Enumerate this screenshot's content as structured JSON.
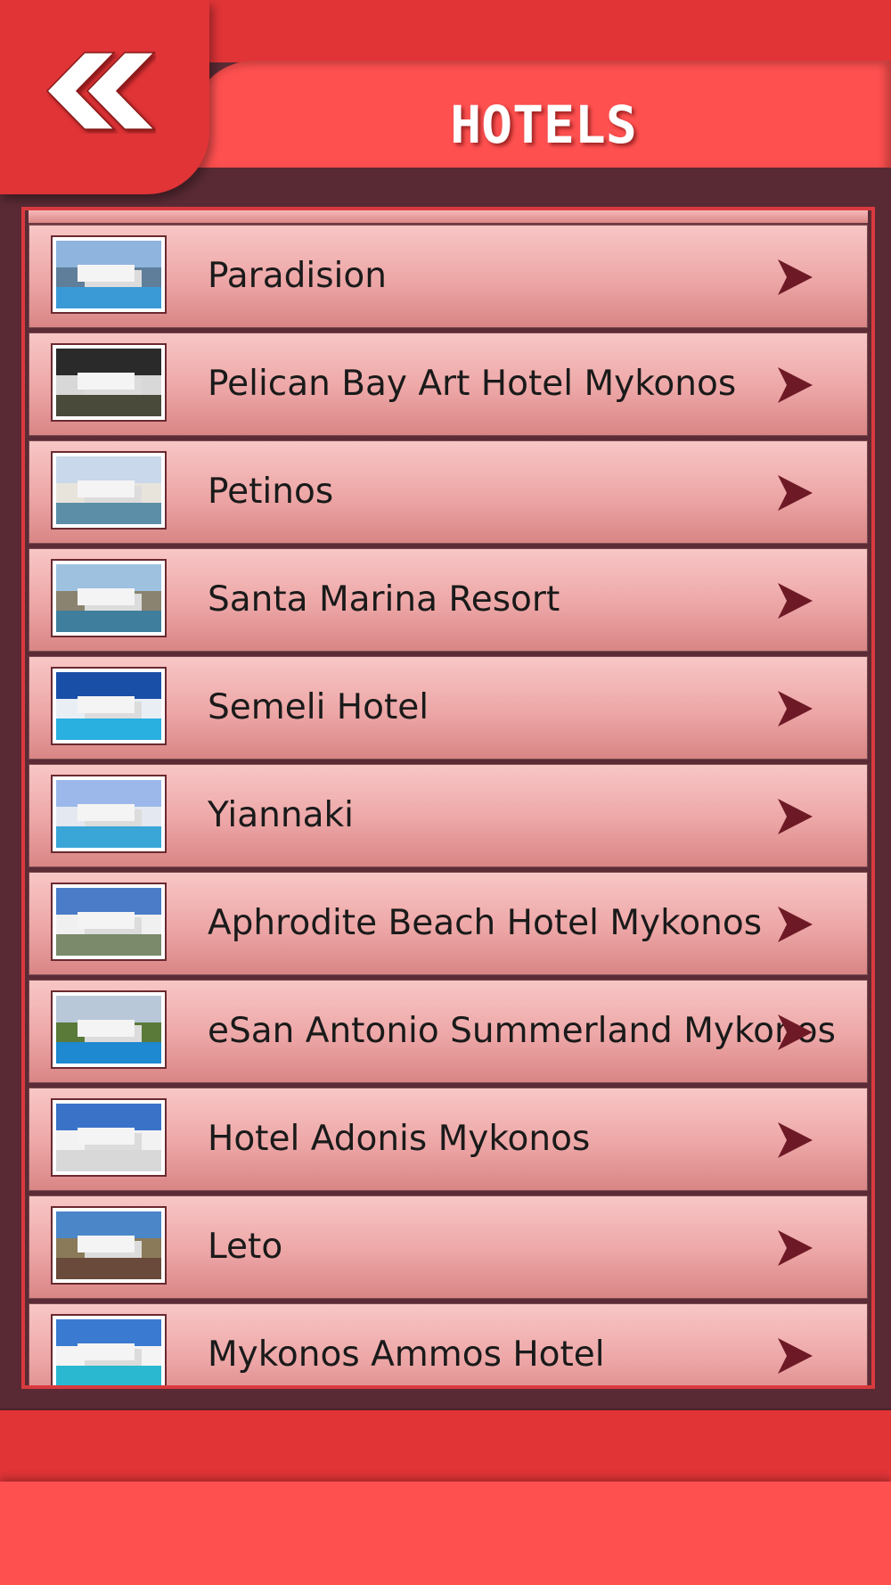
{
  "header": {
    "title": "HOTELS",
    "back_icon": "double-chevron-left-icon"
  },
  "colors": {
    "header_red": "#e03437",
    "title_bar": "#ff5050",
    "background": "#5a2a34",
    "row_gradient_top": "#f8c6c6",
    "row_gradient_bottom": "#d98585",
    "arrow": "#6e1a26"
  },
  "list": {
    "items": [
      {
        "label": "Paradision",
        "thumb": {
          "sky": "#8fb4de",
          "mid": "#5f7e9a",
          "bot": "#3a9ad6"
        }
      },
      {
        "label": "Pelican Bay Art Hotel Mykonos",
        "thumb": {
          "sky": "#2a2a2a",
          "mid": "#d8d8d8",
          "bot": "#4a4a3a"
        }
      },
      {
        "label": "Petinos",
        "thumb": {
          "sky": "#c9d8ea",
          "mid": "#e8e4dc",
          "bot": "#5c8ea8"
        }
      },
      {
        "label": "Santa Marina Resort",
        "thumb": {
          "sky": "#9ec1e0",
          "mid": "#8a8370",
          "bot": "#3f7e9c"
        }
      },
      {
        "label": "Semeli Hotel",
        "thumb": {
          "sky": "#1a4fa8",
          "mid": "#e8eef4",
          "bot": "#2ab0e0"
        }
      },
      {
        "label": "Yiannaki",
        "thumb": {
          "sky": "#9cb8ea",
          "mid": "#e4e8f0",
          "bot": "#3aa6d8"
        }
      },
      {
        "label": "Aphrodite Beach Hotel Mykonos",
        "thumb": {
          "sky": "#4a7cc8",
          "mid": "#f0f0f0",
          "bot": "#7a8a6a"
        }
      },
      {
        "label": "eSan Antonio Summerland Mykonos",
        "thumb": {
          "sky": "#b8c8d8",
          "mid": "#5a7a3a",
          "bot": "#1e88d0"
        }
      },
      {
        "label": "Hotel Adonis Mykonos",
        "thumb": {
          "sky": "#3a72c8",
          "mid": "#f2f2f2",
          "bot": "#d8d8d8"
        }
      },
      {
        "label": "Leto",
        "thumb": {
          "sky": "#4a86c8",
          "mid": "#8a7a5a",
          "bot": "#6a4a3a"
        }
      },
      {
        "label": "Mykonos Ammos Hotel",
        "thumb": {
          "sky": "#3a7ad0",
          "mid": "#f4f4f4",
          "bot": "#2ab8d0"
        }
      }
    ],
    "arrow_icon": "triangle-right-icon",
    "thumbnail_icon": "hotel-photo-icon"
  }
}
